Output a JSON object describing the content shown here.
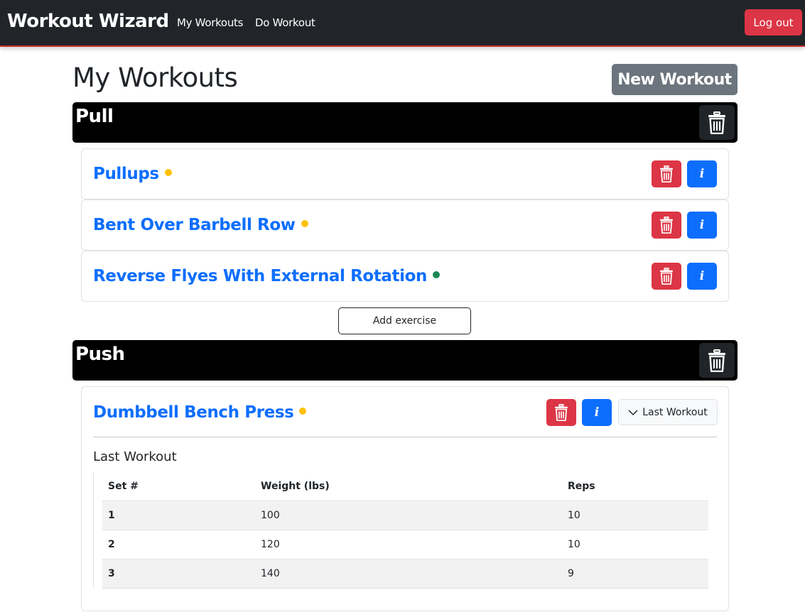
{
  "nav": {
    "brand": "Workout Wizard",
    "links": [
      "My Workouts",
      "Do Workout"
    ],
    "logout_label": "Log out"
  },
  "page": {
    "title": "My Workouts",
    "new_workout_label": "New Workout",
    "add_exercise_label": "Add exercise"
  },
  "groups": [
    {
      "title": "Pull",
      "exercises": [
        {
          "name": "Pullups",
          "status_color": "#ffc107"
        },
        {
          "name": "Bent Over Barbell Row",
          "status_color": "#ffc107"
        },
        {
          "name": "Reverse Flyes With External Rotation",
          "status_color": "#198754"
        }
      ]
    },
    {
      "title": "Push",
      "exercises": [
        {
          "name": "Dumbbell Bench Press",
          "status_color": "#ffc107",
          "toggle_label": "Last Workout",
          "last_workout": {
            "heading": "Last Workout",
            "columns": [
              "Set #",
              "Weight (lbs)",
              "Reps"
            ],
            "rows": [
              [
                "1",
                "100",
                "10"
              ],
              [
                "2",
                "120",
                "10"
              ],
              [
                "3",
                "140",
                "9"
              ]
            ]
          }
        }
      ]
    }
  ],
  "icons": {
    "trash": "trash-icon",
    "info": "info-icon",
    "chevron": "chevron-down-icon"
  },
  "info_glyph": "i",
  "colors": {
    "navbar": "#212529",
    "danger": "#dc3545",
    "primary": "#0d6efd",
    "secondary": "#6c757d",
    "warning_dot": "#ffc107",
    "success_dot": "#198754"
  }
}
